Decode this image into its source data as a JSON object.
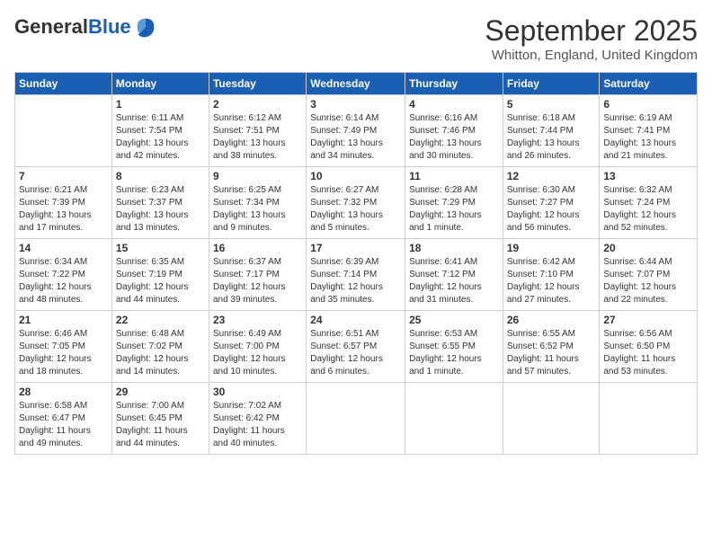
{
  "logo": {
    "general": "General",
    "blue": "Blue"
  },
  "header": {
    "month": "September 2025",
    "location": "Whitton, England, United Kingdom"
  },
  "weekdays": [
    "Sunday",
    "Monday",
    "Tuesday",
    "Wednesday",
    "Thursday",
    "Friday",
    "Saturday"
  ],
  "weeks": [
    [
      {
        "day": "",
        "info": ""
      },
      {
        "day": "1",
        "info": "Sunrise: 6:11 AM\nSunset: 7:54 PM\nDaylight: 13 hours\nand 42 minutes."
      },
      {
        "day": "2",
        "info": "Sunrise: 6:12 AM\nSunset: 7:51 PM\nDaylight: 13 hours\nand 38 minutes."
      },
      {
        "day": "3",
        "info": "Sunrise: 6:14 AM\nSunset: 7:49 PM\nDaylight: 13 hours\nand 34 minutes."
      },
      {
        "day": "4",
        "info": "Sunrise: 6:16 AM\nSunset: 7:46 PM\nDaylight: 13 hours\nand 30 minutes."
      },
      {
        "day": "5",
        "info": "Sunrise: 6:18 AM\nSunset: 7:44 PM\nDaylight: 13 hours\nand 26 minutes."
      },
      {
        "day": "6",
        "info": "Sunrise: 6:19 AM\nSunset: 7:41 PM\nDaylight: 13 hours\nand 21 minutes."
      }
    ],
    [
      {
        "day": "7",
        "info": "Sunrise: 6:21 AM\nSunset: 7:39 PM\nDaylight: 13 hours\nand 17 minutes."
      },
      {
        "day": "8",
        "info": "Sunrise: 6:23 AM\nSunset: 7:37 PM\nDaylight: 13 hours\nand 13 minutes."
      },
      {
        "day": "9",
        "info": "Sunrise: 6:25 AM\nSunset: 7:34 PM\nDaylight: 13 hours\nand 9 minutes."
      },
      {
        "day": "10",
        "info": "Sunrise: 6:27 AM\nSunset: 7:32 PM\nDaylight: 13 hours\nand 5 minutes."
      },
      {
        "day": "11",
        "info": "Sunrise: 6:28 AM\nSunset: 7:29 PM\nDaylight: 13 hours\nand 1 minute."
      },
      {
        "day": "12",
        "info": "Sunrise: 6:30 AM\nSunset: 7:27 PM\nDaylight: 12 hours\nand 56 minutes."
      },
      {
        "day": "13",
        "info": "Sunrise: 6:32 AM\nSunset: 7:24 PM\nDaylight: 12 hours\nand 52 minutes."
      }
    ],
    [
      {
        "day": "14",
        "info": "Sunrise: 6:34 AM\nSunset: 7:22 PM\nDaylight: 12 hours\nand 48 minutes."
      },
      {
        "day": "15",
        "info": "Sunrise: 6:35 AM\nSunset: 7:19 PM\nDaylight: 12 hours\nand 44 minutes."
      },
      {
        "day": "16",
        "info": "Sunrise: 6:37 AM\nSunset: 7:17 PM\nDaylight: 12 hours\nand 39 minutes."
      },
      {
        "day": "17",
        "info": "Sunrise: 6:39 AM\nSunset: 7:14 PM\nDaylight: 12 hours\nand 35 minutes."
      },
      {
        "day": "18",
        "info": "Sunrise: 6:41 AM\nSunset: 7:12 PM\nDaylight: 12 hours\nand 31 minutes."
      },
      {
        "day": "19",
        "info": "Sunrise: 6:42 AM\nSunset: 7:10 PM\nDaylight: 12 hours\nand 27 minutes."
      },
      {
        "day": "20",
        "info": "Sunrise: 6:44 AM\nSunset: 7:07 PM\nDaylight: 12 hours\nand 22 minutes."
      }
    ],
    [
      {
        "day": "21",
        "info": "Sunrise: 6:46 AM\nSunset: 7:05 PM\nDaylight: 12 hours\nand 18 minutes."
      },
      {
        "day": "22",
        "info": "Sunrise: 6:48 AM\nSunset: 7:02 PM\nDaylight: 12 hours\nand 14 minutes."
      },
      {
        "day": "23",
        "info": "Sunrise: 6:49 AM\nSunset: 7:00 PM\nDaylight: 12 hours\nand 10 minutes."
      },
      {
        "day": "24",
        "info": "Sunrise: 6:51 AM\nSunset: 6:57 PM\nDaylight: 12 hours\nand 6 minutes."
      },
      {
        "day": "25",
        "info": "Sunrise: 6:53 AM\nSunset: 6:55 PM\nDaylight: 12 hours\nand 1 minute."
      },
      {
        "day": "26",
        "info": "Sunrise: 6:55 AM\nSunset: 6:52 PM\nDaylight: 11 hours\nand 57 minutes."
      },
      {
        "day": "27",
        "info": "Sunrise: 6:56 AM\nSunset: 6:50 PM\nDaylight: 11 hours\nand 53 minutes."
      }
    ],
    [
      {
        "day": "28",
        "info": "Sunrise: 6:58 AM\nSunset: 6:47 PM\nDaylight: 11 hours\nand 49 minutes."
      },
      {
        "day": "29",
        "info": "Sunrise: 7:00 AM\nSunset: 6:45 PM\nDaylight: 11 hours\nand 44 minutes."
      },
      {
        "day": "30",
        "info": "Sunrise: 7:02 AM\nSunset: 6:42 PM\nDaylight: 11 hours\nand 40 minutes."
      },
      {
        "day": "",
        "info": ""
      },
      {
        "day": "",
        "info": ""
      },
      {
        "day": "",
        "info": ""
      },
      {
        "day": "",
        "info": ""
      }
    ]
  ]
}
